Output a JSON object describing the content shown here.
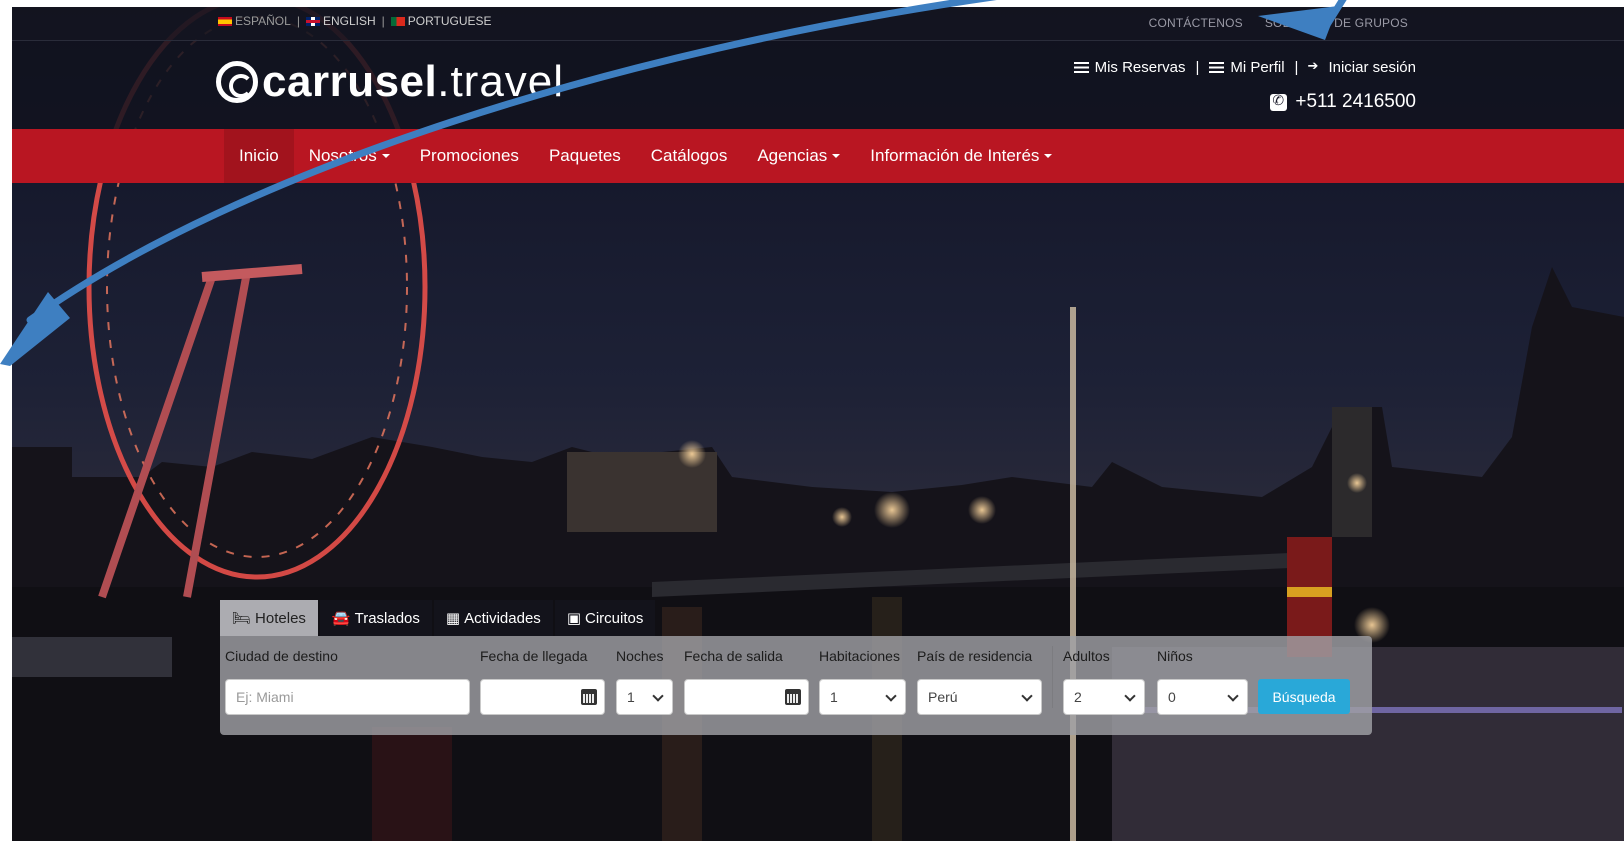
{
  "languages": [
    {
      "label": "ESPAÑOL",
      "flag": "es"
    },
    {
      "label": "ENGLISH",
      "flag": "uk"
    },
    {
      "label": "PORTUGUESE",
      "flag": "pt"
    }
  ],
  "top_links": [
    "CONTÁCTENOS",
    "SOLICITUD DE GRUPOS"
  ],
  "logo": {
    "bold": "carrusel",
    "light": ".travel"
  },
  "account": {
    "reservations": "Mis Reservas",
    "profile": "Mi Perfil",
    "login": "Iniciar sesión",
    "separator": "|",
    "phone": "+511 2416500"
  },
  "nav": {
    "items": [
      {
        "label": "Inicio",
        "dropdown": false
      },
      {
        "label": "Nosotros",
        "dropdown": true
      },
      {
        "label": "Promociones",
        "dropdown": false
      },
      {
        "label": "Paquetes",
        "dropdown": false
      },
      {
        "label": "Catálogos",
        "dropdown": false
      },
      {
        "label": "Agencias",
        "dropdown": true
      },
      {
        "label": "Información de Interés",
        "dropdown": true
      }
    ]
  },
  "search": {
    "tabs": [
      {
        "label": "Hoteles",
        "icon": "bed-icon"
      },
      {
        "label": "Traslados",
        "icon": "car-icon"
      },
      {
        "label": "Actividades",
        "icon": "map-icon"
      },
      {
        "label": "Circuitos",
        "icon": "suitcase-icon"
      }
    ],
    "labels": {
      "destination": "Ciudad de destino",
      "arrival": "Fecha de llegada",
      "nights": "Noches",
      "departure": "Fecha de salida",
      "rooms": "Habitaciones",
      "country": "País de residencia",
      "adults": "Adultos",
      "children": "Niños"
    },
    "values": {
      "destination_placeholder": "Ej: Miami",
      "arrival": "",
      "nights": "1",
      "departure": "",
      "rooms": "1",
      "country": "Perú",
      "adults": "2",
      "children": "0"
    },
    "button": "Búsqueda"
  },
  "colors": {
    "nav_red": "#b91622",
    "search_button": "#29a8d8",
    "annotation_arrow": "#3e7fc1"
  }
}
